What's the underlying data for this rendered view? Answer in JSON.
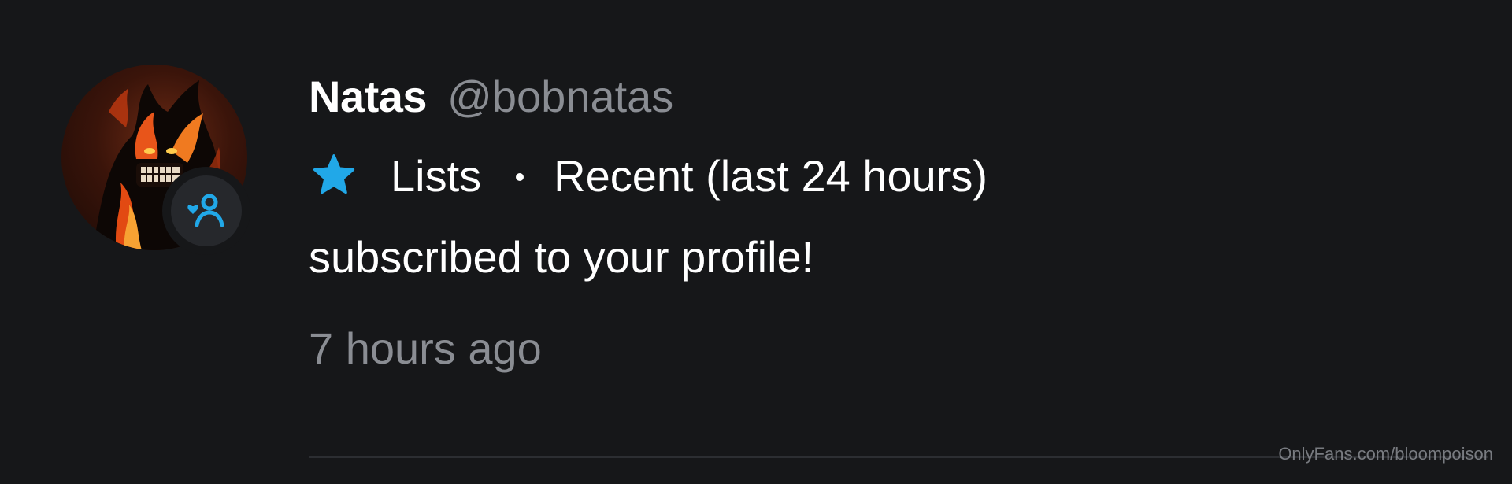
{
  "notification": {
    "display_name": "Natas",
    "username": "@bobnatas",
    "list_icon": "star-icon",
    "list_label": "Lists",
    "separator": "•",
    "list_name": "Recent (last 24 hours)",
    "message": "subscribed to your profile!",
    "timestamp": "7 hours ago",
    "badge_icon": "subscriber-icon"
  },
  "watermark": "OnlyFans.com/bloompoison",
  "colors": {
    "background": "#161719",
    "accent": "#21a8e8",
    "primary_text": "#ffffff",
    "secondary_text": "#8a8d93"
  }
}
